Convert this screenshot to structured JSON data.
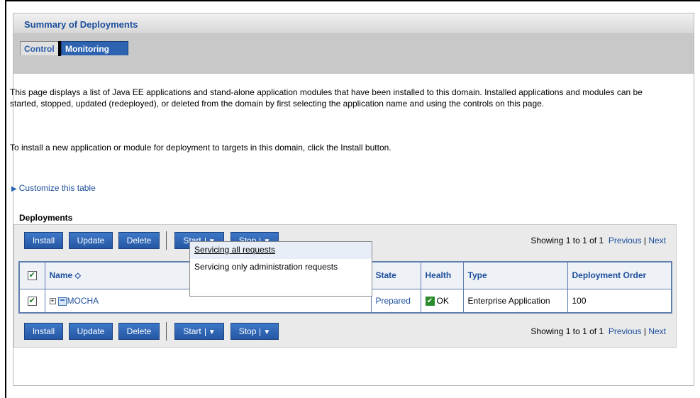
{
  "panel": {
    "title": "Summary of Deployments"
  },
  "tabs": [
    {
      "label": "Control"
    },
    {
      "label": "Monitoring"
    }
  ],
  "description": {
    "p1": "This page displays a list of Java EE applications and stand-alone application modules that have been installed to this domain. Installed applications and modules can be started, stopped, updated (redeployed), or deleted from the domain by first selecting the application name and using the controls on this page.",
    "p2": "To install a new application or module for deployment to targets in this domain, click the Install button."
  },
  "customize_link": "Customize this table",
  "deployments_title": "Deployments",
  "toolbar": {
    "install": "Install",
    "update": "Update",
    "delete": "Delete",
    "start": "Start",
    "stop": "Stop",
    "caret": "▼"
  },
  "paging": {
    "showing": "Showing 1 to 1 of 1",
    "previous": "Previous",
    "sep": "|",
    "next": "Next"
  },
  "table": {
    "headers": {
      "name": "Name",
      "sort_icon": "⬦",
      "state": "State",
      "health": "Health",
      "type": "Type",
      "order": "Deployment Order"
    },
    "rows": [
      {
        "name": "MOCHA",
        "state": "Prepared",
        "health": "OK",
        "type": "Enterprise Application",
        "order": "100",
        "checked": true
      }
    ]
  },
  "start_menu": {
    "items": [
      {
        "label": "Servicing all requests"
      },
      {
        "label": "Servicing only administration requests"
      }
    ]
  },
  "glyphs": {
    "check": "✔",
    "expand": "+",
    "triangle": "▶"
  },
  "colors": {
    "accent": "#2d63b0",
    "link": "#1c4e9c",
    "health_ok": "#2b8a2b"
  }
}
